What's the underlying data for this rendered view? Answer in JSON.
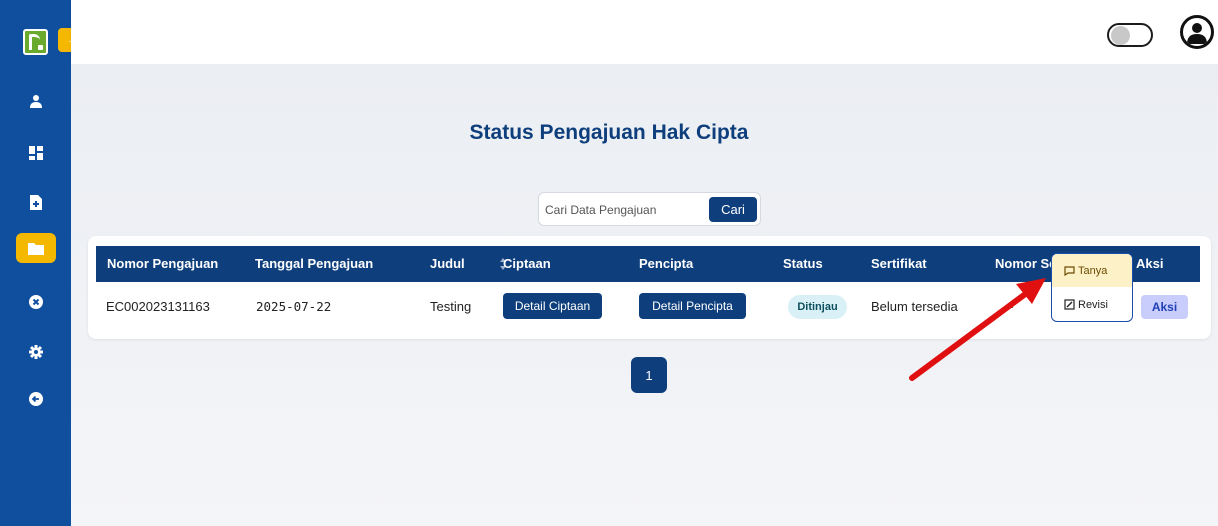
{
  "sidebar": {
    "expand_glyph": "→",
    "items": [
      {
        "icon": "user-icon"
      },
      {
        "icon": "dashboard-icon"
      },
      {
        "icon": "file-add-icon"
      },
      {
        "icon": "folder-icon",
        "active": true
      },
      {
        "icon": "x-circle-icon"
      },
      {
        "icon": "gear-icon"
      },
      {
        "icon": "logout-icon"
      }
    ]
  },
  "page": {
    "title": "Status Pengajuan Hak Cipta"
  },
  "search": {
    "placeholder": "Cari Data Pengajuan",
    "button_label": "Cari"
  },
  "table": {
    "headers": [
      "Nomor Pengajuan",
      "Tanggal Pengajuan",
      "Judul",
      "Ciptaan",
      "Pencipta",
      "Status",
      "Sertifikat",
      "Nomor Se",
      "Aksi"
    ],
    "rows": [
      {
        "nomor_pengajuan": "EC002023131163",
        "tanggal_pengajuan": "2025-07-22",
        "judul": "Testing",
        "ciptaan_button": "Detail Ciptaan",
        "pencipta_button": "Detail Pencipta",
        "status": "Ditinjau",
        "sertifikat": "Belum tersedia",
        "nomor_sertifikat": "-",
        "aksi_button": "Aksi"
      }
    ]
  },
  "dropdown": {
    "items": [
      {
        "label": "Tanya",
        "icon": "chat-icon"
      },
      {
        "label": "Revisi",
        "icon": "edit-icon"
      }
    ]
  },
  "pagination": {
    "current_page": "1"
  },
  "colors": {
    "sidebar": "#0f4f9e",
    "primary": "#0e3f7c",
    "accent": "#f5b800",
    "annotation_arrow": "#e01010"
  }
}
